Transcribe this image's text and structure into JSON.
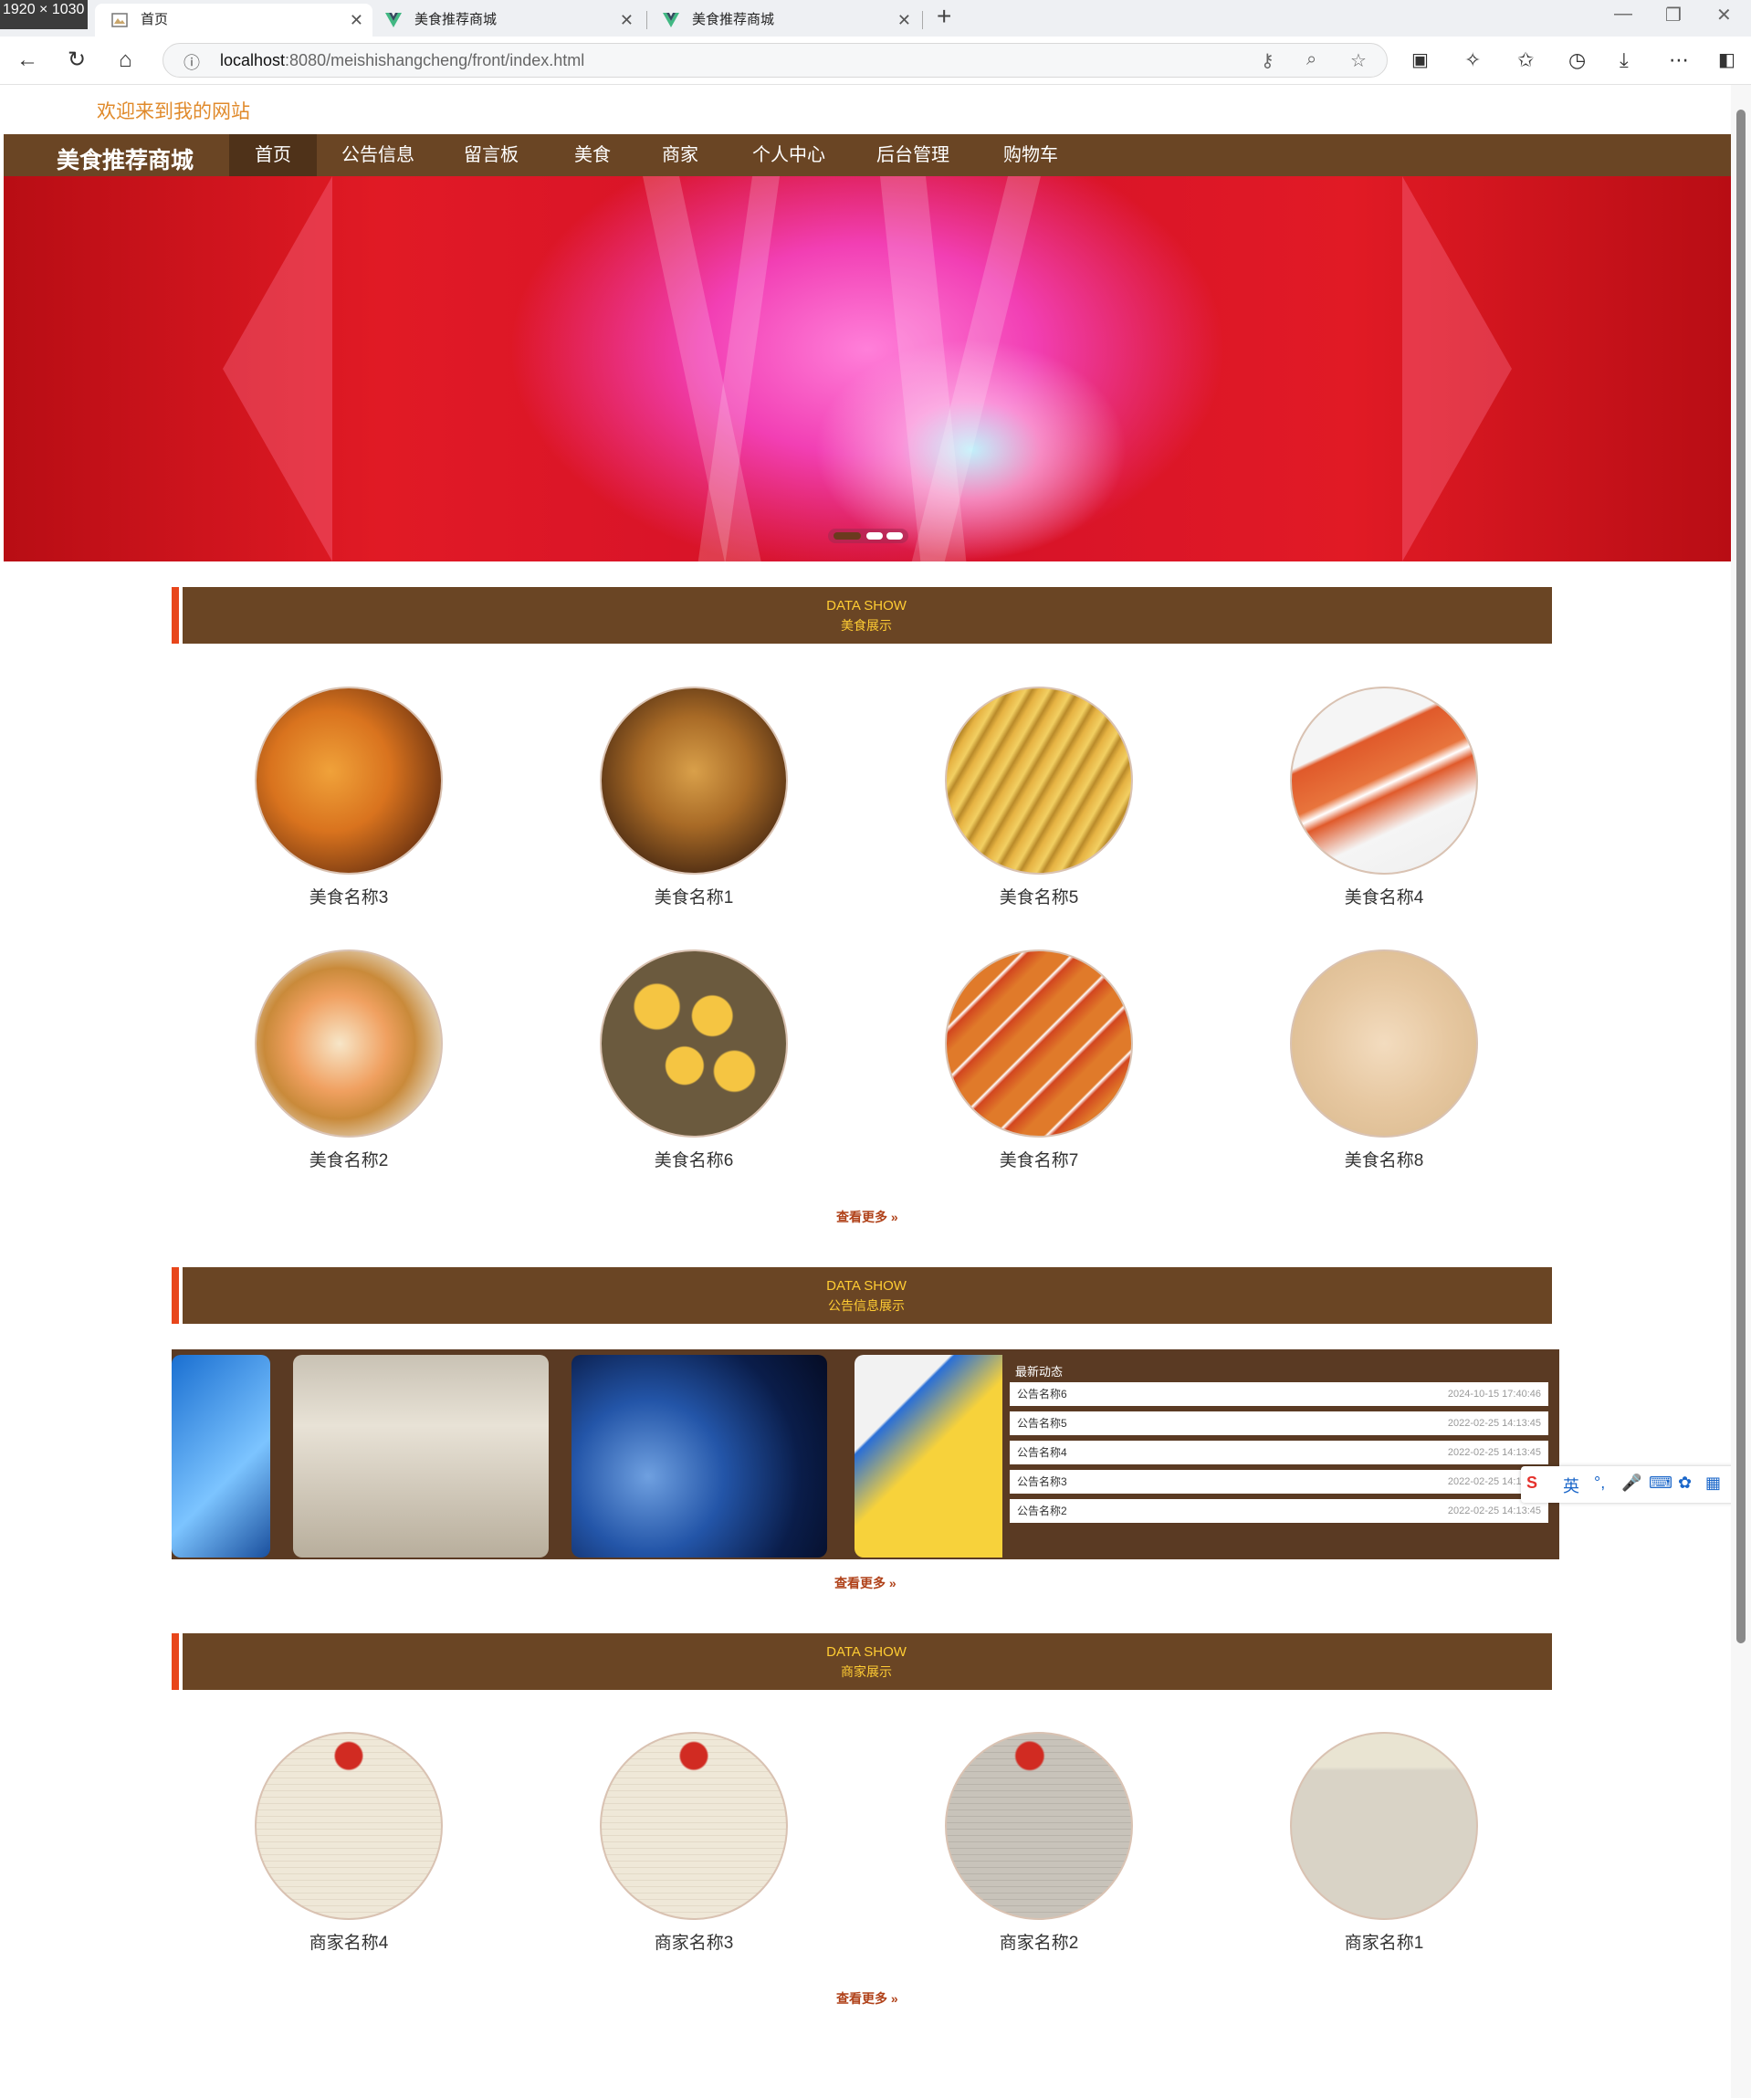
{
  "browser": {
    "profile_label": "1920 × 1030",
    "tabs": [
      {
        "label": "首页",
        "active": true
      },
      {
        "label": "美食推荐商城",
        "active": false
      },
      {
        "label": "美食推荐商城",
        "active": false
      }
    ],
    "url_host": "localhost",
    "url_path": ":8080/meishishangcheng/front/index.html"
  },
  "site": {
    "welcome": "欢迎来到我的网站",
    "brand": "美食推荐商城",
    "nav": [
      "首页",
      "公告信息",
      "留言板",
      "美食",
      "商家",
      "个人中心",
      "后台管理",
      "购物车"
    ],
    "active_nav": "首页"
  },
  "sections": {
    "food": {
      "en": "DATA SHOW",
      "cn": "美食展示",
      "more": "查看更多 »"
    },
    "notice": {
      "en": "DATA SHOW",
      "cn": "公告信息展示",
      "more": "查看更多 »"
    },
    "merchant": {
      "en": "DATA SHOW",
      "cn": "商家展示",
      "more": "查看更多 »"
    }
  },
  "foods": [
    "美食名称3",
    "美食名称1",
    "美食名称5",
    "美食名称4",
    "美食名称2",
    "美食名称6",
    "美食名称7",
    "美食名称8"
  ],
  "notices": {
    "title": "最新动态",
    "items": [
      {
        "title": "公告名称6",
        "date": "2024-10-15 17:40:46"
      },
      {
        "title": "公告名称5",
        "date": "2022-02-25 14:13:45"
      },
      {
        "title": "公告名称4",
        "date": "2022-02-25 14:13:45"
      },
      {
        "title": "公告名称3",
        "date": "2022-02-25 14:13:45"
      },
      {
        "title": "公告名称2",
        "date": "2022-02-25 14:13:45"
      }
    ]
  },
  "merchants": [
    "商家名称4",
    "商家名称3",
    "商家名称2",
    "商家名称1"
  ],
  "ime": {
    "lang": "英"
  }
}
